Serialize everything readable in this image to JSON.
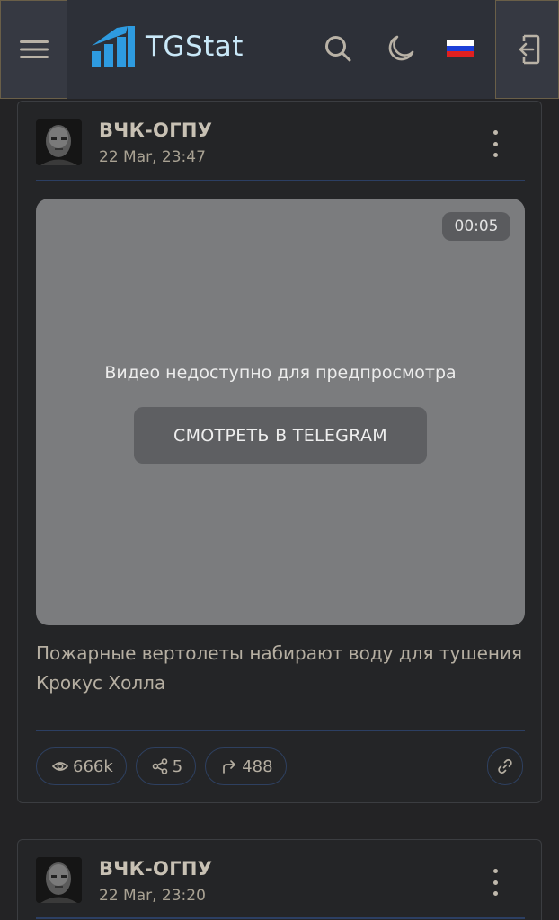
{
  "header": {
    "brand": "TGStat",
    "icons": {
      "menu": "hamburger-menu-icon",
      "search": "search-icon",
      "theme": "moon-icon",
      "language": "russian-flag-icon",
      "logout": "logout-icon"
    },
    "colors": {
      "brand_blue": "#2e9be0",
      "brand_text": "#c9e8f8"
    }
  },
  "posts": [
    {
      "channel": "ВЧК-ОГПУ",
      "date": "22 Mar, 23:47",
      "video": {
        "duration": "00:05",
        "message": "Видео недоступно для предпросмотра",
        "button": "СМОТРЕТЬ В TELEGRAM"
      },
      "text": "Пожарные вертолеты набирают воду для тушения Крокус Холла",
      "stats": {
        "views": "666k",
        "shares": "5",
        "forwards": "488"
      }
    },
    {
      "channel": "ВЧК-ОГПУ",
      "date": "22 Mar, 23:20"
    }
  ]
}
